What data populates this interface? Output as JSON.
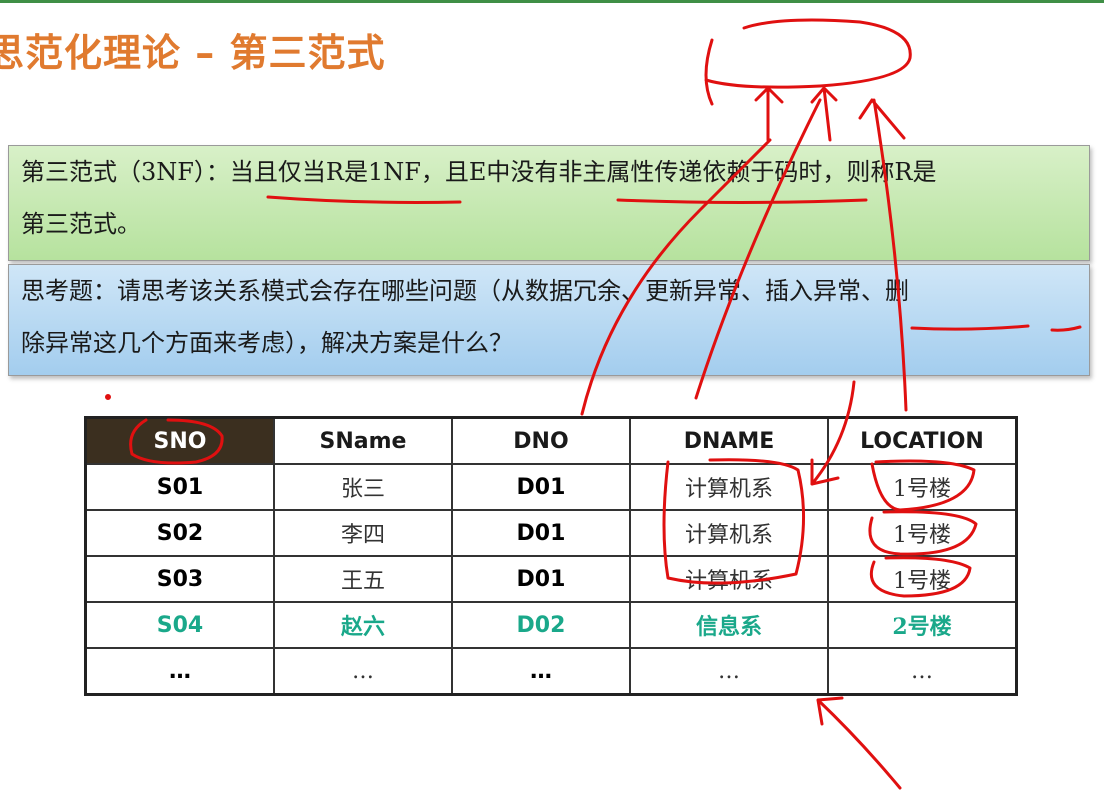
{
  "slide": {
    "title": "思范化理论 – 第三范式",
    "definition_line1": "第三范式（3NF）：当且仅当R是1NF，且E中没有非主属性传递依赖于码时，则称R是",
    "definition_line2": "第三范式。",
    "question_line1": "思考题：请思考该关系模式会存在哪些问题（从数据冗余、更新异常、插入异常、删",
    "question_line2": "除异常这几个方面来考虑），解决方案是什么？"
  },
  "table": {
    "headers": [
      "SNO",
      "SName",
      "DNO",
      "DNAME",
      "LOCATION"
    ],
    "rows": [
      [
        "S01",
        "张三",
        "D01",
        "计算机系",
        "1号楼"
      ],
      [
        "S02",
        "李四",
        "D01",
        "计算机系",
        "1号楼"
      ],
      [
        "S03",
        "王五",
        "D01",
        "计算机系",
        "1号楼"
      ],
      [
        "S04",
        "赵六",
        "D02",
        "信息系",
        "2号楼"
      ],
      [
        "…",
        "…",
        "…",
        "…",
        "…"
      ]
    ]
  },
  "colors": {
    "title": "#e07a2f",
    "key_header_bg": "#3b2f1f",
    "highlight_row": "#1aa88a",
    "annotation_ink": "#e01010"
  }
}
